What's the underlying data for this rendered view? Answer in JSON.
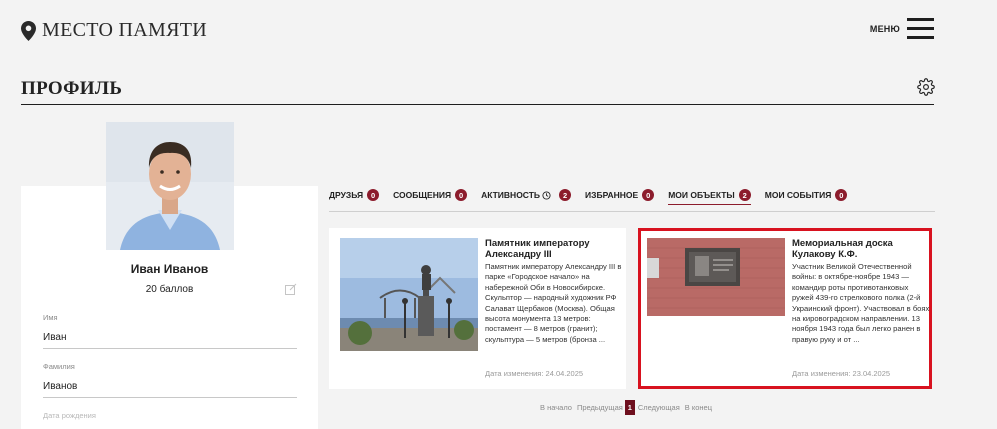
{
  "header": {
    "brand": "МЕСТО ПАМЯТИ",
    "menu_label": "МЕНЮ"
  },
  "page": {
    "title": "ПРОФИЛЬ"
  },
  "profile": {
    "name": "Иван Иванов",
    "points": "20 баллов",
    "fields": [
      {
        "label": "Имя",
        "value": "Иван"
      },
      {
        "label": "Фамилия",
        "value": "Иванов"
      },
      {
        "label": "Дата рождения",
        "value": ""
      }
    ]
  },
  "tabs": [
    {
      "label": "ДРУЗЬЯ",
      "count": "0"
    },
    {
      "label": "СООБЩЕНИЯ",
      "count": "0"
    },
    {
      "label": "АКТИВНОСТЬ",
      "count": "2"
    },
    {
      "label": "ИЗБРАННОЕ",
      "count": "0"
    },
    {
      "label": "МОИ ОБЪЕКТЫ",
      "count": "2",
      "active": true
    },
    {
      "label": "МОИ СОБЫТИЯ",
      "count": "0"
    }
  ],
  "objects": [
    {
      "title": "Памятник императору Александру III",
      "description": "Памятник императору Александру III в парке «Городское начало» на набережной Оби в Новосибирске. Скульптор — народный художник РФ Салават Щербаков (Москва). Общая высота монумента 13 метров: постамент — 8 метров (гранит); скульптура — 5 метров (бронза ...",
      "date": "Дата изменения: 24.04.2025"
    },
    {
      "title": "Мемориальная доска Кулакову К.Ф.",
      "description": "Участник Великой Отечественной войны: в октябре-ноябре 1943 — командир роты противотанковых ружей 439-го стрелкового полка (2-й Украинский фронт). Участвовал в боях на кировоградском направлении. 13 ноября 1943 года был легко ранен в правую руку и от ...",
      "date": "Дата изменения: 23.04.2025"
    }
  ],
  "pagination": {
    "first": "В начало",
    "prev": "Предыдущая",
    "current": "1",
    "next": "Следующая",
    "last": "В конец"
  },
  "colors": {
    "accent": "#8c1c2c",
    "highlight": "#d8121f",
    "background": "#f3f3f3"
  },
  "icons": [
    "map-pin-icon",
    "hamburger-menu-icon",
    "settings-gear-icon",
    "edit-icon",
    "clock-icon"
  ]
}
